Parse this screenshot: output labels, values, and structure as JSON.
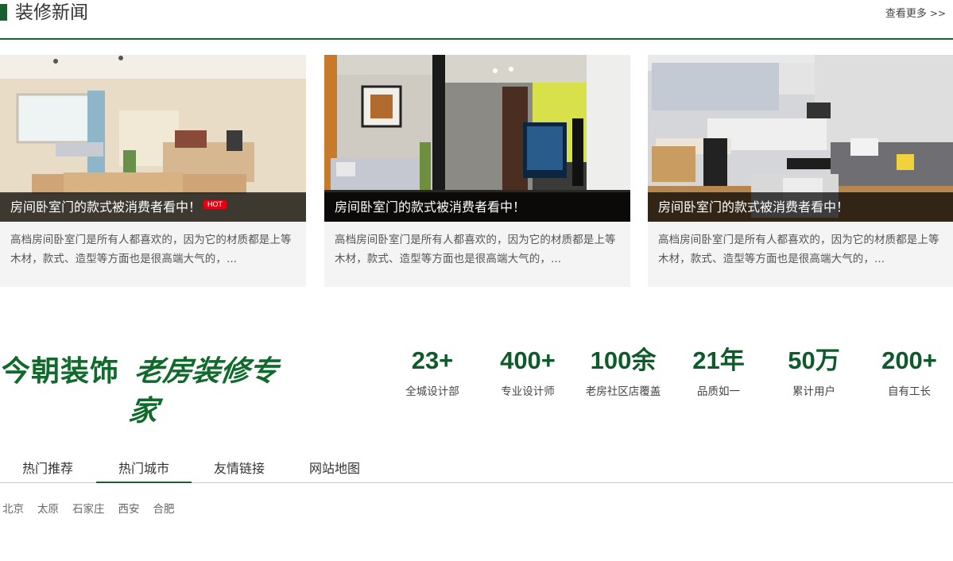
{
  "header": {
    "title": "装修新闻",
    "more_label": "查看更多",
    "more_icon": "double-chevron-right-icon"
  },
  "news": [
    {
      "caption": "房间卧室门的款式被消费者看中！",
      "hot": "HOT",
      "desc": "高档房间卧室门是所有人都喜欢的，因为它的材质都是上等木材，款式、造型等方面也是很高端大气的，..."
    },
    {
      "caption": "房间卧室门的款式被消费者看中！",
      "hot": null,
      "desc": "高档房间卧室门是所有人都喜欢的，因为它的材质都是上等木材，款式、造型等方面也是很高端大气的，..."
    },
    {
      "caption": "房间卧室门的款式被消费者看中！",
      "hot": null,
      "desc": "高档房间卧室门是所有人都喜欢的，因为它的材质都是上等木材，款式、造型等方面也是很高端大气的，..."
    }
  ],
  "brand": {
    "name": "今朝装饰",
    "slogan": "老房装修专家"
  },
  "stats": [
    {
      "value": "23+",
      "label": "全城设计部"
    },
    {
      "value": "400+",
      "label": "专业设计师"
    },
    {
      "value": "100余",
      "label": "老房社区店覆盖"
    },
    {
      "value": "21年",
      "label": "品质如一"
    },
    {
      "value": "50万",
      "label": "累计用户"
    },
    {
      "value": "200+",
      "label": "自有工长"
    }
  ],
  "tabs": [
    {
      "label": "热门推荐",
      "active": false
    },
    {
      "label": "热门城市",
      "active": true
    },
    {
      "label": "友情链接",
      "active": false
    },
    {
      "label": "网站地图",
      "active": false
    }
  ],
  "cities": [
    "北京",
    "太原",
    "石家庄",
    "西安",
    "合肥"
  ],
  "colors": {
    "brand_green": "#1b5e2f",
    "hot_red": "#e60012",
    "card_bg": "#f4f4f4"
  }
}
